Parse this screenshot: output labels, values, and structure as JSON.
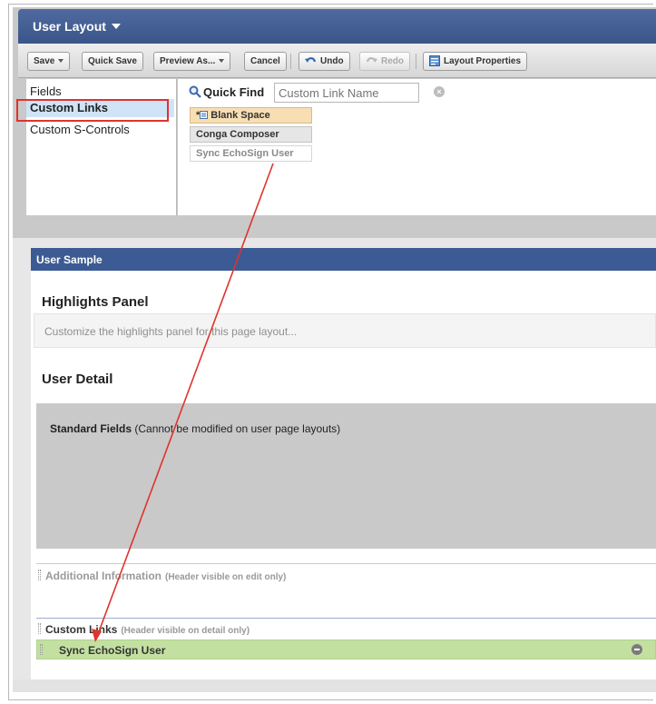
{
  "editor": {
    "title": "User Layout",
    "toolbar": {
      "save": "Save",
      "quick_save": "Quick Save",
      "preview_as": "Preview As...",
      "cancel": "Cancel",
      "undo": "Undo",
      "redo": "Redo",
      "layout_properties": "Layout Properties"
    },
    "categories": [
      "Fields",
      "Custom Links",
      "Custom S-Controls"
    ],
    "selected_category": "Custom Links",
    "quick_find": {
      "label": "Quick Find",
      "placeholder": "Custom Link Name"
    },
    "palette_items": [
      "Blank Space",
      "Conga Composer",
      "Sync EchoSign User"
    ],
    "blank_space_prefix": "*"
  },
  "layout": {
    "sample_title": "User Sample",
    "highlights_heading": "Highlights Panel",
    "highlights_hint": "Customize the highlights panel for this page layout...",
    "user_detail_heading": "User Detail",
    "standard_fields_label": "Standard Fields",
    "standard_fields_note": "(Cannot be modified on user page layouts)",
    "additional_info_heading": "Additional Information",
    "additional_info_note": "(Header visible on edit only)",
    "custom_links_heading": "Custom Links",
    "custom_links_note": "(Header visible on detail only)",
    "custom_link_item": "Sync EchoSign User"
  },
  "colors": {
    "header_blue": "#3c5b94",
    "selected_category_bg": "#cfe4f7",
    "annotation_red": "#e0332d",
    "dropped_item_green": "#c3e0a1",
    "blank_space_orange": "#f7deb3"
  }
}
